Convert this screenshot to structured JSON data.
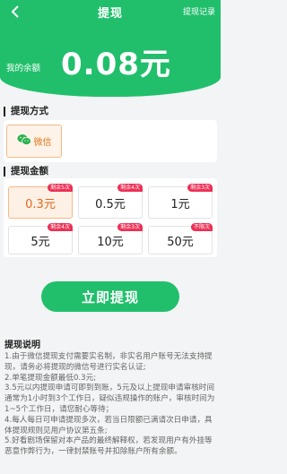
{
  "header": {
    "title": "提现",
    "records_link": "提现记录",
    "balance_label": "我的余额",
    "balance_value": "0.08元",
    "brand_color": "#21bf6c"
  },
  "method": {
    "section_title": "提现方式",
    "wechat_label": "微信",
    "wechat_icon": "wechat-icon"
  },
  "amounts": {
    "section_title": "提现金额",
    "options": [
      {
        "label": "0.3元",
        "badge": "剩余5次",
        "selected": true
      },
      {
        "label": "0.5元",
        "badge": "剩余4次",
        "selected": false
      },
      {
        "label": "1元",
        "badge": "剩余3次",
        "selected": false
      },
      {
        "label": "5元",
        "badge": "剩余4次",
        "selected": false
      },
      {
        "label": "10元",
        "badge": "剩余3次",
        "selected": false
      },
      {
        "label": "50元",
        "badge": "不限次",
        "selected": false
      }
    ]
  },
  "withdraw_button": "立即提现",
  "notes": {
    "title": "提现说明",
    "lines": [
      "1.由于微信提现支付需要实名制，非实名用户账号无法支持提现，请务必将提现的微信号进行实名认证;",
      "2.单笔提现金额最低0.3元;",
      "3.5元以内提现申请可即到到账，5元及以上提现申请审核时间通常为1小时到3个工作日，疑似违规操作的账户，审核时间为1~5个工作日，请您耐心等待；",
      "4.每人每日可申请提现多次，若当日限额已满请次日申请，具体提现规则见用户协议第五条;",
      "5.好看剧场保留对本产品的最终解释权，若发现用户有外挂等恶意作弊行为，一律封禁账号并扣除账户所有余额。"
    ]
  }
}
